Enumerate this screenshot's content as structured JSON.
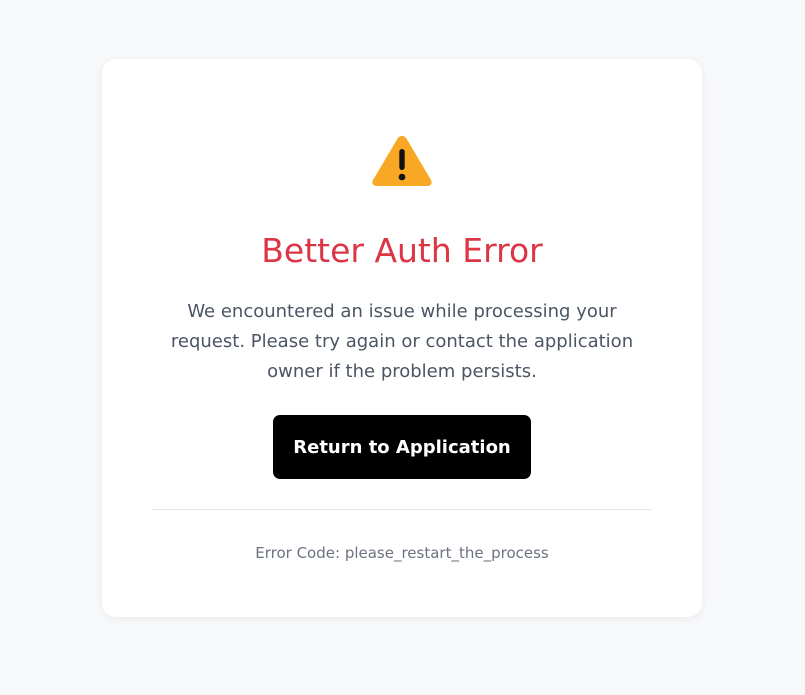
{
  "colors": {
    "page_background": "#f7f8fa",
    "card_background": "#ffffff",
    "title": "#dc3545",
    "warning_icon": "#f9a825",
    "button_background": "#000000",
    "button_text": "#ffffff"
  },
  "icon": "warning-icon",
  "title": "Better Auth Error",
  "message": "We encountered an issue while processing your request. Please try again or contact the application owner if the problem persists.",
  "button_label": "Return to Application",
  "error_code": {
    "label": "Error Code: ",
    "value": "please_restart_the_process"
  }
}
